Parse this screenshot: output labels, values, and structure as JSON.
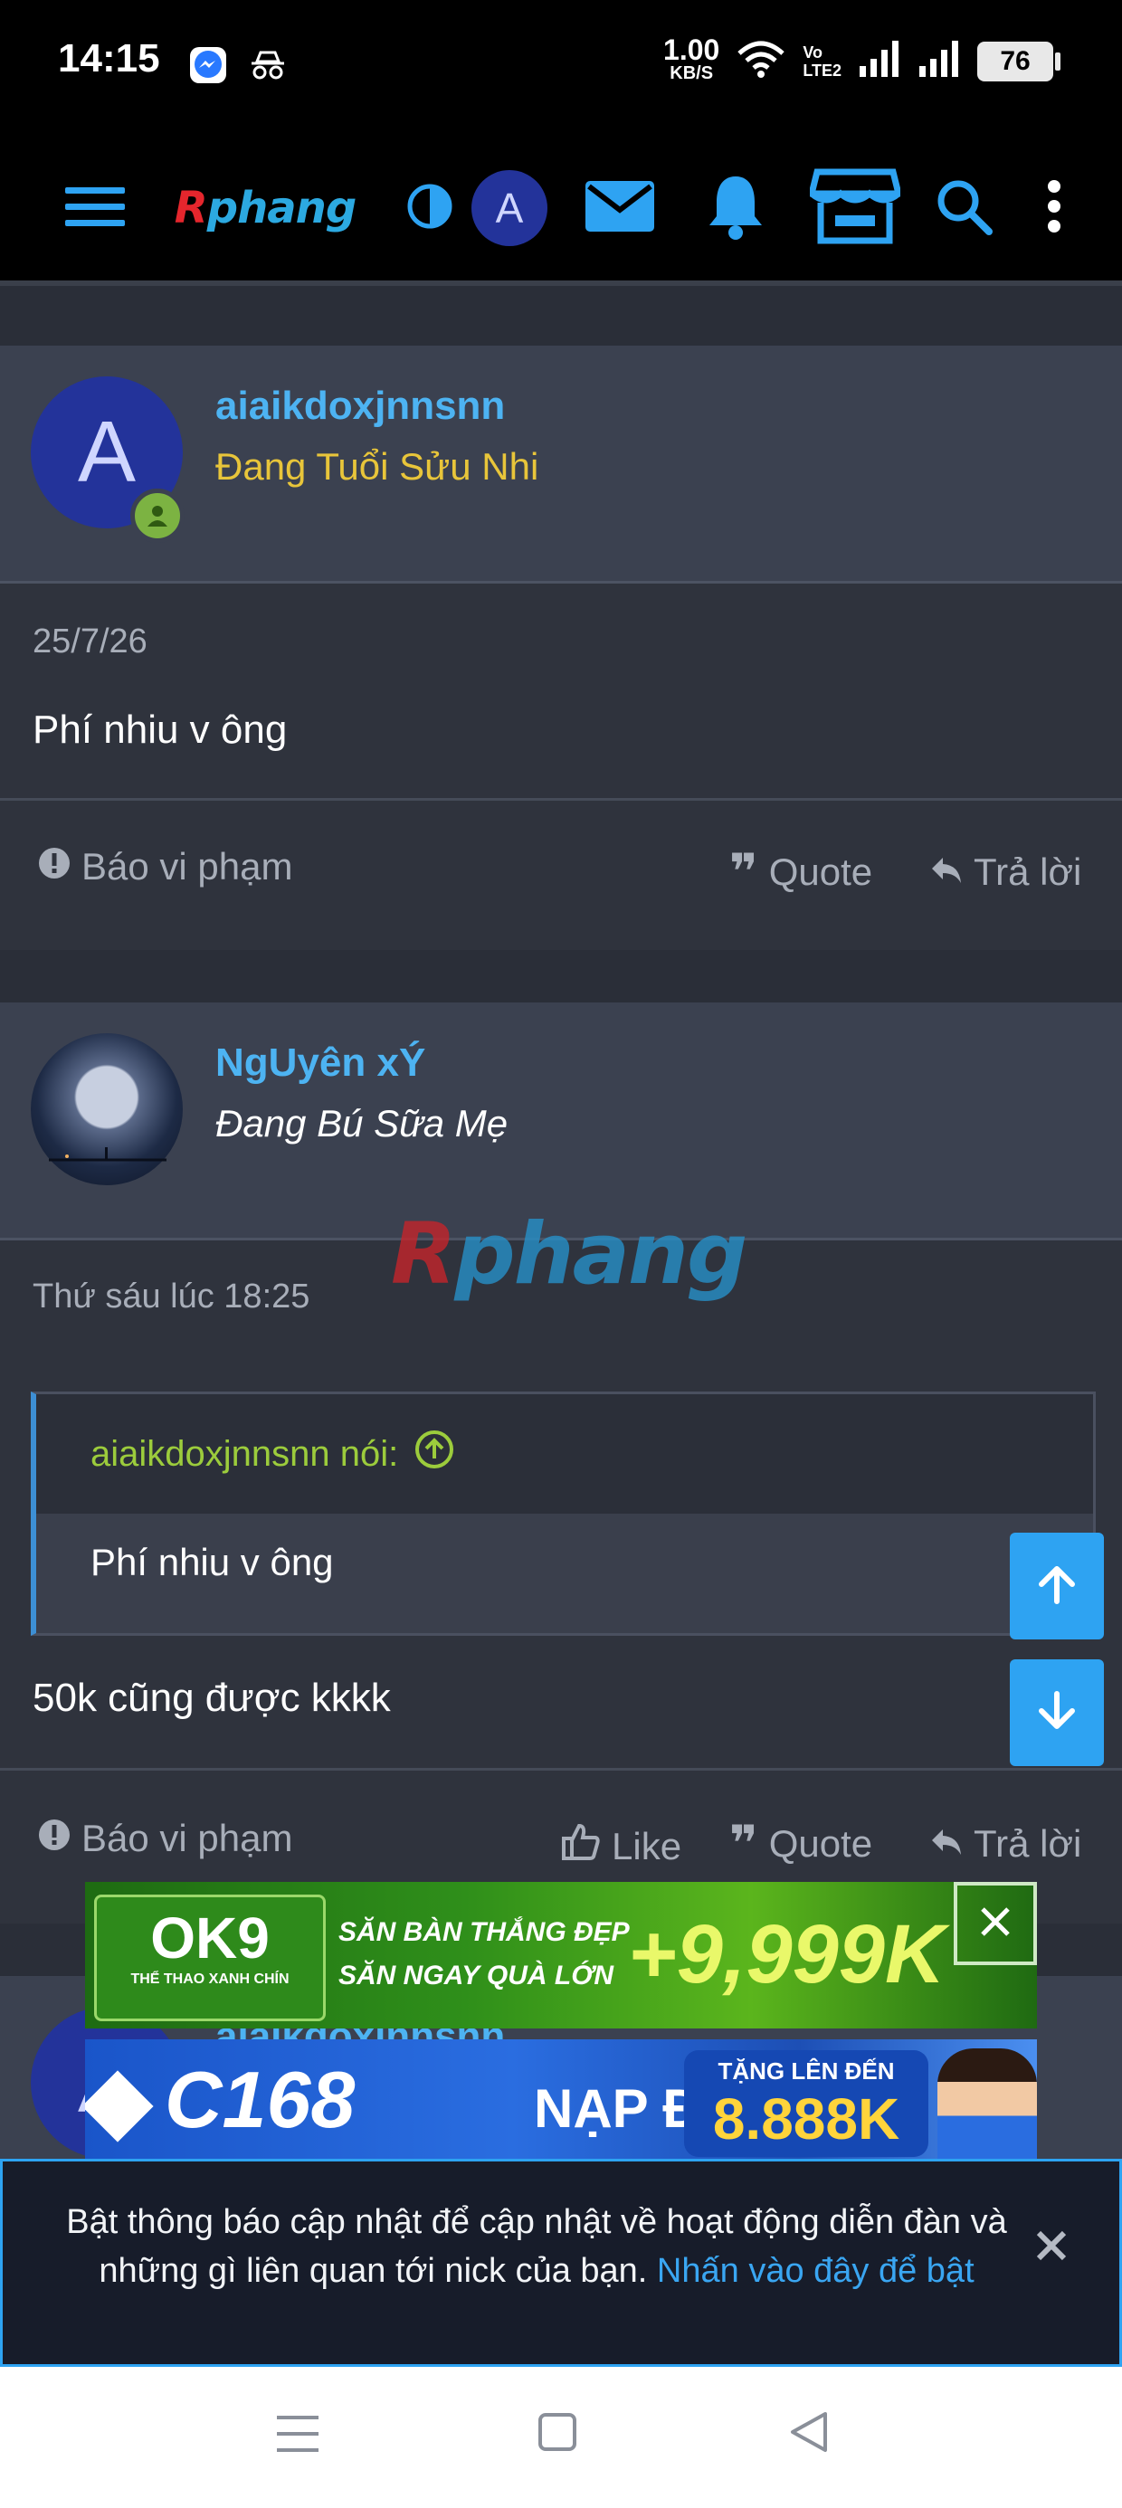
{
  "status_bar": {
    "time": "14:15",
    "net_speed_value": "1.00",
    "net_speed_unit": "KB/S",
    "volte_label": "Vo\nLTE2",
    "battery": "76"
  },
  "header": {
    "logo_first": "R",
    "logo_rest": "phang",
    "avatar_letter": "A"
  },
  "posts": [
    {
      "avatar_letter": "A",
      "username": "aiaikdoxjnnsnn",
      "user_title": "Đang Tuổi Sửu Nhi",
      "date": "25/7/26",
      "text": "Phí nhiu v ông",
      "actions": {
        "report": "Báo vi phạm",
        "quote": "Quote",
        "reply": "Trả lời"
      }
    },
    {
      "username": "NgUyên xÝ",
      "user_title": "Đang Bú Sữa Mẹ",
      "date": "Thứ sáu lúc 18:25",
      "quote": {
        "author": "aiaikdoxjnnsnn nói:",
        "text": "Phí nhiu v ông"
      },
      "text": "50k cũng được kkkk",
      "actions": {
        "report": "Báo vi phạm",
        "like": "Like",
        "quote": "Quote",
        "reply": "Trả lời"
      }
    },
    {
      "avatar_letter": "A",
      "username": "aiaikdoxjnnsnn"
    }
  ],
  "watermark": {
    "first": "R",
    "rest": "phang"
  },
  "ads": [
    {
      "brand": "OK9",
      "tagline": "THỂ THAO XANH CHÍN",
      "line1": "SĂN BÀN THẮNG ĐẸP",
      "line2": "SĂN NGAY QUÀ LỚN",
      "amount": "+9,999K"
    },
    {
      "brand": "C168",
      "headline": "NẠP ĐẦU",
      "promo_label": "TẶNG LÊN ĐẾN",
      "amount": "8.888K"
    }
  ],
  "notification": {
    "text": "Bật thông báo cập nhật để cập nhật về hoạt động diễn đàn và những gì liên quan tới nick của bạn. ",
    "link": "Nhấn vào đây để bật"
  },
  "icons": {
    "menu": "hamburger-icon",
    "theme": "theme-toggle-icon",
    "mail": "mail-icon",
    "bell": "bell-icon",
    "store": "store-icon",
    "search": "search-icon",
    "more": "more-vert-icon"
  },
  "colors": {
    "accent": "#2ea3f2",
    "username": "#4db3f2",
    "title_gold": "#e8c53a",
    "quote_green": "#9ccc3c"
  }
}
